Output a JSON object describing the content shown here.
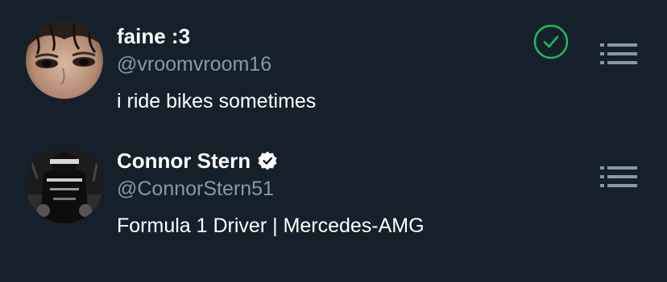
{
  "colors": {
    "background": "#15202b",
    "handle": "#8899a6",
    "accent_green": "#17bf63",
    "icon_gray": "#8899a6"
  },
  "users": [
    {
      "display_name": "faine :3",
      "handle": "@vroomvroom16",
      "bio": "i ride bikes sometimes",
      "verified": false,
      "selected": true,
      "avatar_icon": "avatar-photo",
      "action_icon": "list-icon"
    },
    {
      "display_name": "Connor Stern",
      "handle": "@ConnorStern51",
      "bio": "Formula 1 Driver | Mercedes-AMG",
      "verified": true,
      "selected": false,
      "avatar_icon": "avatar-photo",
      "action_icon": "list-icon"
    }
  ]
}
